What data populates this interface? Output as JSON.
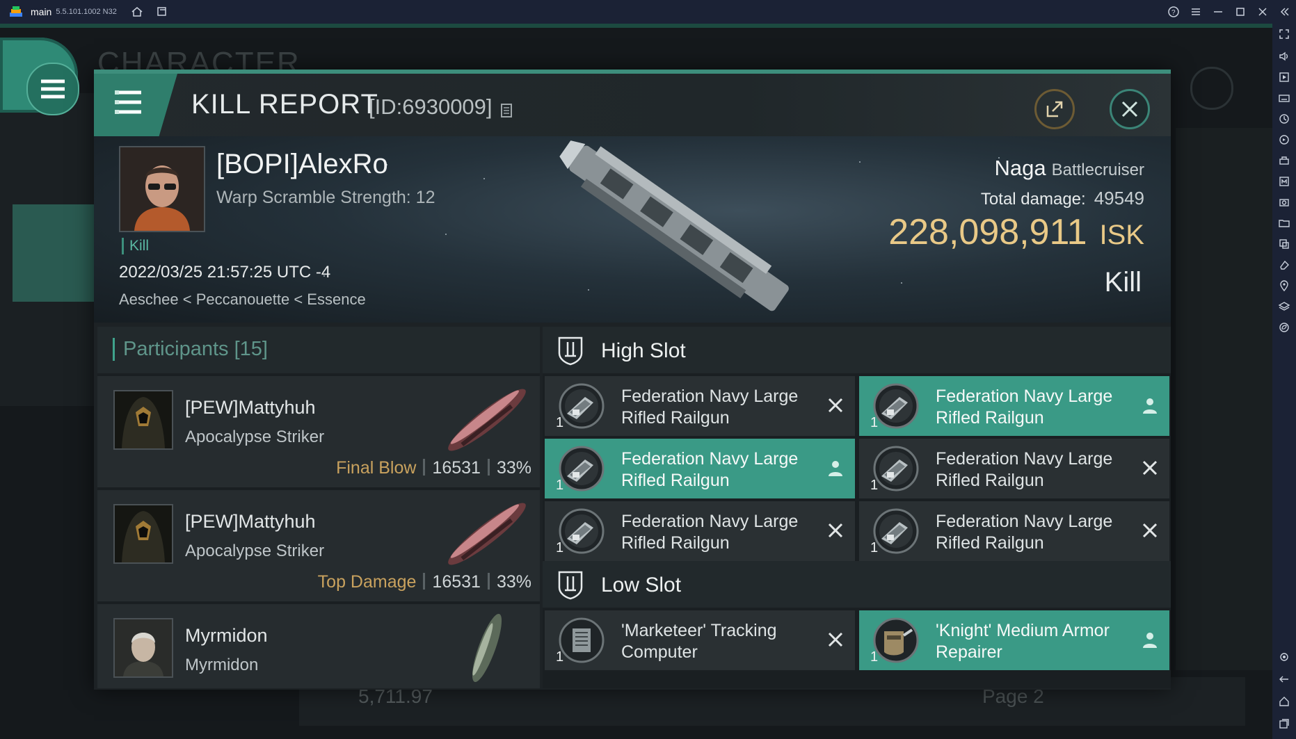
{
  "emulator": {
    "app_name": "main",
    "version": "5.5.101.1002 N32"
  },
  "background": {
    "character_title": "CHARACTER",
    "wallet": "5,711.97",
    "page": "Page 2"
  },
  "dialog": {
    "title": "KILL REPORT",
    "report_id": "[ID:6930009]",
    "victim": {
      "name": "[BOPI]AlexRo",
      "warp_scramble": "Warp Scramble Strength: 12",
      "tag": "Kill",
      "time": "2022/03/25 21:57:25 UTC -4",
      "location": "Aeschee < Peccanouette < Essence"
    },
    "ship": {
      "name": "Naga",
      "class": "Battlecruiser",
      "total_damage_label": "Total damage:",
      "total_damage": "49549",
      "isk_value": "228,098,911",
      "isk_unit": "ISK",
      "result": "Kill"
    },
    "participants": {
      "label": "Participants",
      "count": "[15]",
      "rows": [
        {
          "name": "[PEW]Mattyhuh",
          "ship": "Apocalypse Striker",
          "role": "Final Blow",
          "damage": "16531",
          "percent": "33%"
        },
        {
          "name": "[PEW]Mattyhuh",
          "ship": "Apocalypse Striker",
          "role": "Top Damage",
          "damage": "16531",
          "percent": "33%"
        },
        {
          "name": "Myrmidon",
          "ship": "Myrmidon",
          "role": "",
          "damage": "",
          "percent": ""
        }
      ]
    },
    "high_slot": {
      "label": "High Slot",
      "modules": [
        {
          "name": "Federation Navy Large Rifled Railgun",
          "qty": "1",
          "status": "destroyed"
        },
        {
          "name": "Federation Navy Large Rifled Railgun",
          "qty": "1",
          "status": "dropped"
        },
        {
          "name": "Federation Navy Large Rifled Railgun",
          "qty": "1",
          "status": "dropped"
        },
        {
          "name": "Federation Navy Large Rifled Railgun",
          "qty": "1",
          "status": "destroyed"
        },
        {
          "name": "Federation Navy Large Rifled Railgun",
          "qty": "1",
          "status": "destroyed"
        },
        {
          "name": "Federation Navy Large Rifled Railgun",
          "qty": "1",
          "status": "destroyed"
        }
      ]
    },
    "low_slot": {
      "label": "Low Slot",
      "modules": [
        {
          "name": "'Marketeer' Tracking Computer",
          "qty": "1",
          "status": "destroyed"
        },
        {
          "name": "'Knight' Medium Armor Repairer",
          "qty": "1",
          "status": "dropped"
        }
      ]
    }
  },
  "colors": {
    "accent": "#3a9a86",
    "isk": "#e9c987",
    "final_blow": "#c9a25e"
  }
}
